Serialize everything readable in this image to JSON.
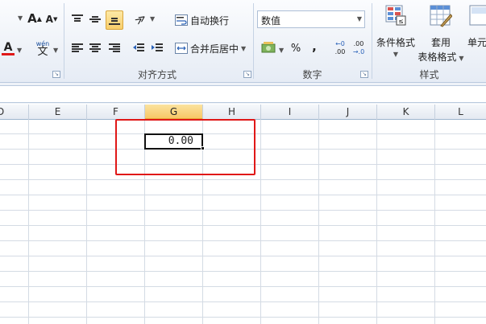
{
  "ribbon": {
    "font_group": {
      "grow_font": "A",
      "shrink_font": "A",
      "font_color_letter": "A",
      "phonetic_top": "wén",
      "phonetic_char": "文"
    },
    "alignment_group": {
      "label": "对齐方式",
      "wrap_text_label": "自动换行",
      "merge_center_label": "合并后居中"
    },
    "number_group": {
      "label": "数字",
      "format_value": "数值",
      "percent_label": "%",
      "comma_label": ",",
      "increase_decimal_top": "←0",
      "increase_decimal_bottom": ".00",
      "decrease_decimal_top": ".00",
      "decrease_decimal_bottom": "→.0"
    },
    "styles_group": {
      "label": "样式",
      "conditional_format_label": "条件格式",
      "table_format_line1": "套用",
      "table_format_line2": "表格格式",
      "cell_styles_label": "单元"
    }
  },
  "columns": [
    "D",
    "E",
    "F",
    "G",
    "H",
    "I",
    "J",
    "K",
    "L"
  ],
  "selected_column": "G",
  "active_cell": {
    "value": "0.00"
  },
  "colors": {
    "highlight": "#e01818",
    "selected_header": "#f7c866",
    "accent": "#4a7ebb"
  }
}
